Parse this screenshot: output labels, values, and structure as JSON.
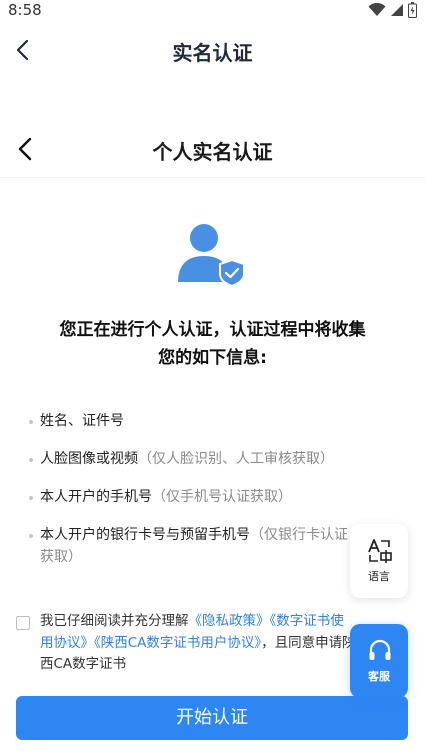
{
  "status_bar": {
    "time": "8:58"
  },
  "app_header": {
    "title": "实名认证"
  },
  "page_header": {
    "title": "个人实名认证"
  },
  "heading": {
    "line1": "您正在进行个人认证，认证过程中将收集",
    "line2": "您的如下信息:"
  },
  "info_items": [
    {
      "label": "姓名、证件号",
      "note": ""
    },
    {
      "label": "人脸图像或视频",
      "note": "（仅人脸识别、人工审核获取）"
    },
    {
      "label": "本人开户的手机号",
      "note": "（仅手机号认证获取）"
    },
    {
      "label": "本人开户的银行卡号与预留手机号",
      "note": "（仅银行卡认证获取）"
    }
  ],
  "consent": {
    "prefix": "我已仔细阅读并充分理解",
    "link1": "《隐私政策》",
    "link2": "《数字证书使用协议》",
    "link3": "《陕西CA数字证书用户协议》",
    "suffix": "，且同意申请陕西CA数字证书",
    "checked": false
  },
  "start_button": {
    "label": "开始认证"
  },
  "floating": {
    "language_label": "语言",
    "service_label": "客服"
  },
  "colors": {
    "primary": "#2d86f2",
    "icon_blue": "#4a90e2",
    "link": "#2f80ed"
  }
}
